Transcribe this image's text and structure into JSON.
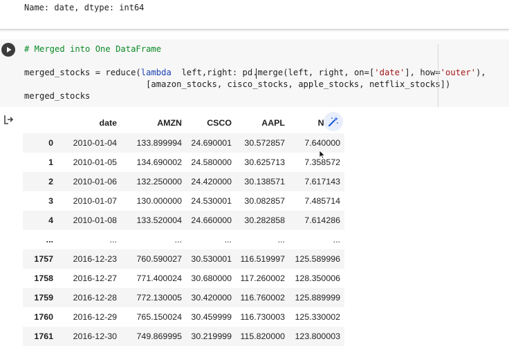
{
  "previous_output": {
    "text": "Name: date, dtype: int64"
  },
  "code_cell": {
    "comment": "# Merged into One DataFrame",
    "line2_a": "merged_stocks = reduce(",
    "line2_kw": "lambda",
    "line2_b": "  left,right: pd.merge(left, right, on=[",
    "line2_str1": "'date'",
    "line2_c": "], how=",
    "line2_str2": "'outer'",
    "line2_d": "),",
    "line3": "                        [amazon_stocks, cisco_stocks, apple_stocks, netflix_stocks])",
    "line4": "merged_stocks"
  },
  "icons": {
    "run": "play-icon",
    "output": "output-arrow-icon",
    "magic": "magic-wand-icon",
    "pointer": "mouse-pointer-icon"
  },
  "dataframe": {
    "columns": [
      "",
      "date",
      "AMZN",
      "CSCO",
      "AAPL",
      "NFLX"
    ],
    "rows": [
      [
        "0",
        "2010-01-04",
        "133.899994",
        "24.690001",
        "30.572857",
        "7.640000"
      ],
      [
        "1",
        "2010-01-05",
        "134.690002",
        "24.580000",
        "30.625713",
        "7.358572"
      ],
      [
        "2",
        "2010-01-06",
        "132.250000",
        "24.420000",
        "30.138571",
        "7.617143"
      ],
      [
        "3",
        "2010-01-07",
        "130.000000",
        "24.530001",
        "30.082857",
        "7.485714"
      ],
      [
        "4",
        "2010-01-08",
        "133.520004",
        "24.660000",
        "30.282858",
        "7.614286"
      ],
      [
        "...",
        "...",
        "...",
        "...",
        "...",
        "..."
      ],
      [
        "1757",
        "2016-12-23",
        "760.590027",
        "30.530001",
        "116.519997",
        "125.589996"
      ],
      [
        "1758",
        "2016-12-27",
        "771.400024",
        "30.680000",
        "117.260002",
        "128.350006"
      ],
      [
        "1759",
        "2016-12-28",
        "772.130005",
        "30.420000",
        "116.760002",
        "125.889999"
      ],
      [
        "1760",
        "2016-12-29",
        "765.150024",
        "30.459999",
        "116.730003",
        "125.330002"
      ],
      [
        "1761",
        "2016-12-30",
        "749.869995",
        "30.219999",
        "115.820000",
        "123.800003"
      ]
    ]
  }
}
